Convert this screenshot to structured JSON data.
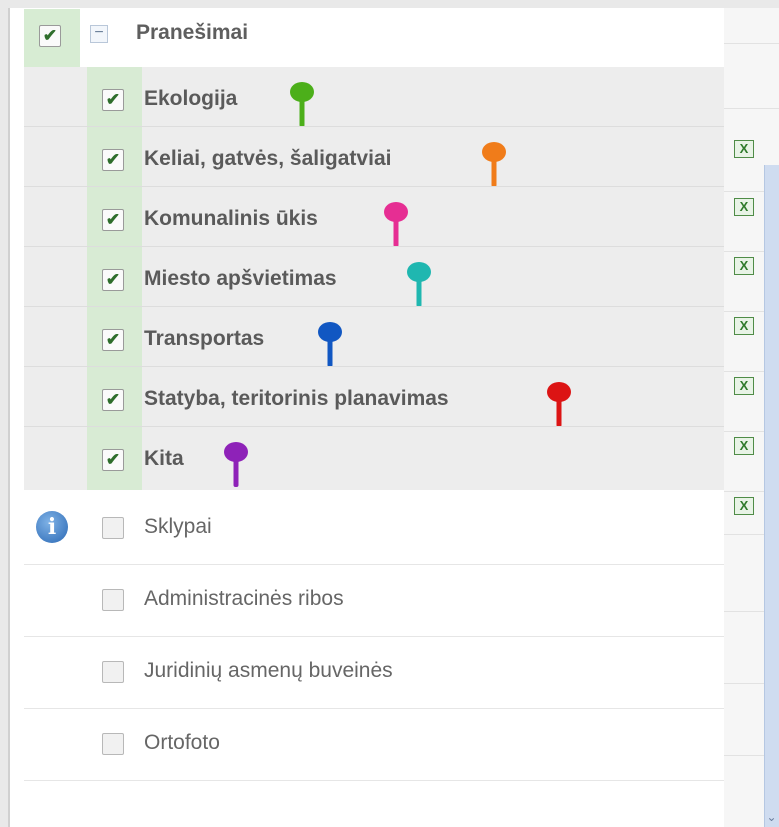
{
  "group": {
    "label": "Pranešimai",
    "checked": true,
    "collapse_glyph": "−"
  },
  "categories": [
    {
      "label": "Ekologija",
      "checked": true,
      "pin_color": "#4caf1a"
    },
    {
      "label": "Keliai, gatvės, šaligatviai",
      "checked": true,
      "pin_color": "#f07c1a"
    },
    {
      "label": "Komunalinis ūkis",
      "checked": true,
      "pin_color": "#e62e93"
    },
    {
      "label": "Miesto apšvietimas",
      "checked": true,
      "pin_color": "#1fb7b0"
    },
    {
      "label": "Transportas",
      "checked": true,
      "pin_color": "#1157c2"
    },
    {
      "label": "Statyba, teritorinis planavimas",
      "checked": true,
      "pin_color": "#dc1414"
    },
    {
      "label": "Kita",
      "checked": true,
      "pin_color": "#8e22b8"
    }
  ],
  "layers": [
    {
      "label": "Sklypai",
      "checked": false,
      "has_info": true
    },
    {
      "label": "Administracinės ribos",
      "checked": false,
      "has_info": false
    },
    {
      "label": "Juridinių asmenų buveinės",
      "checked": false,
      "has_info": false
    },
    {
      "label": "Ortofoto",
      "checked": false,
      "has_info": false
    }
  ],
  "icons": {
    "export": "excel-export-icon",
    "info": "info-icon",
    "pin": "map-pin-icon",
    "scroll": "scroll-down-arrow-icon"
  },
  "glyphs": {
    "check": "✔",
    "excel": "X",
    "info": "i",
    "scroll": "⌄"
  }
}
